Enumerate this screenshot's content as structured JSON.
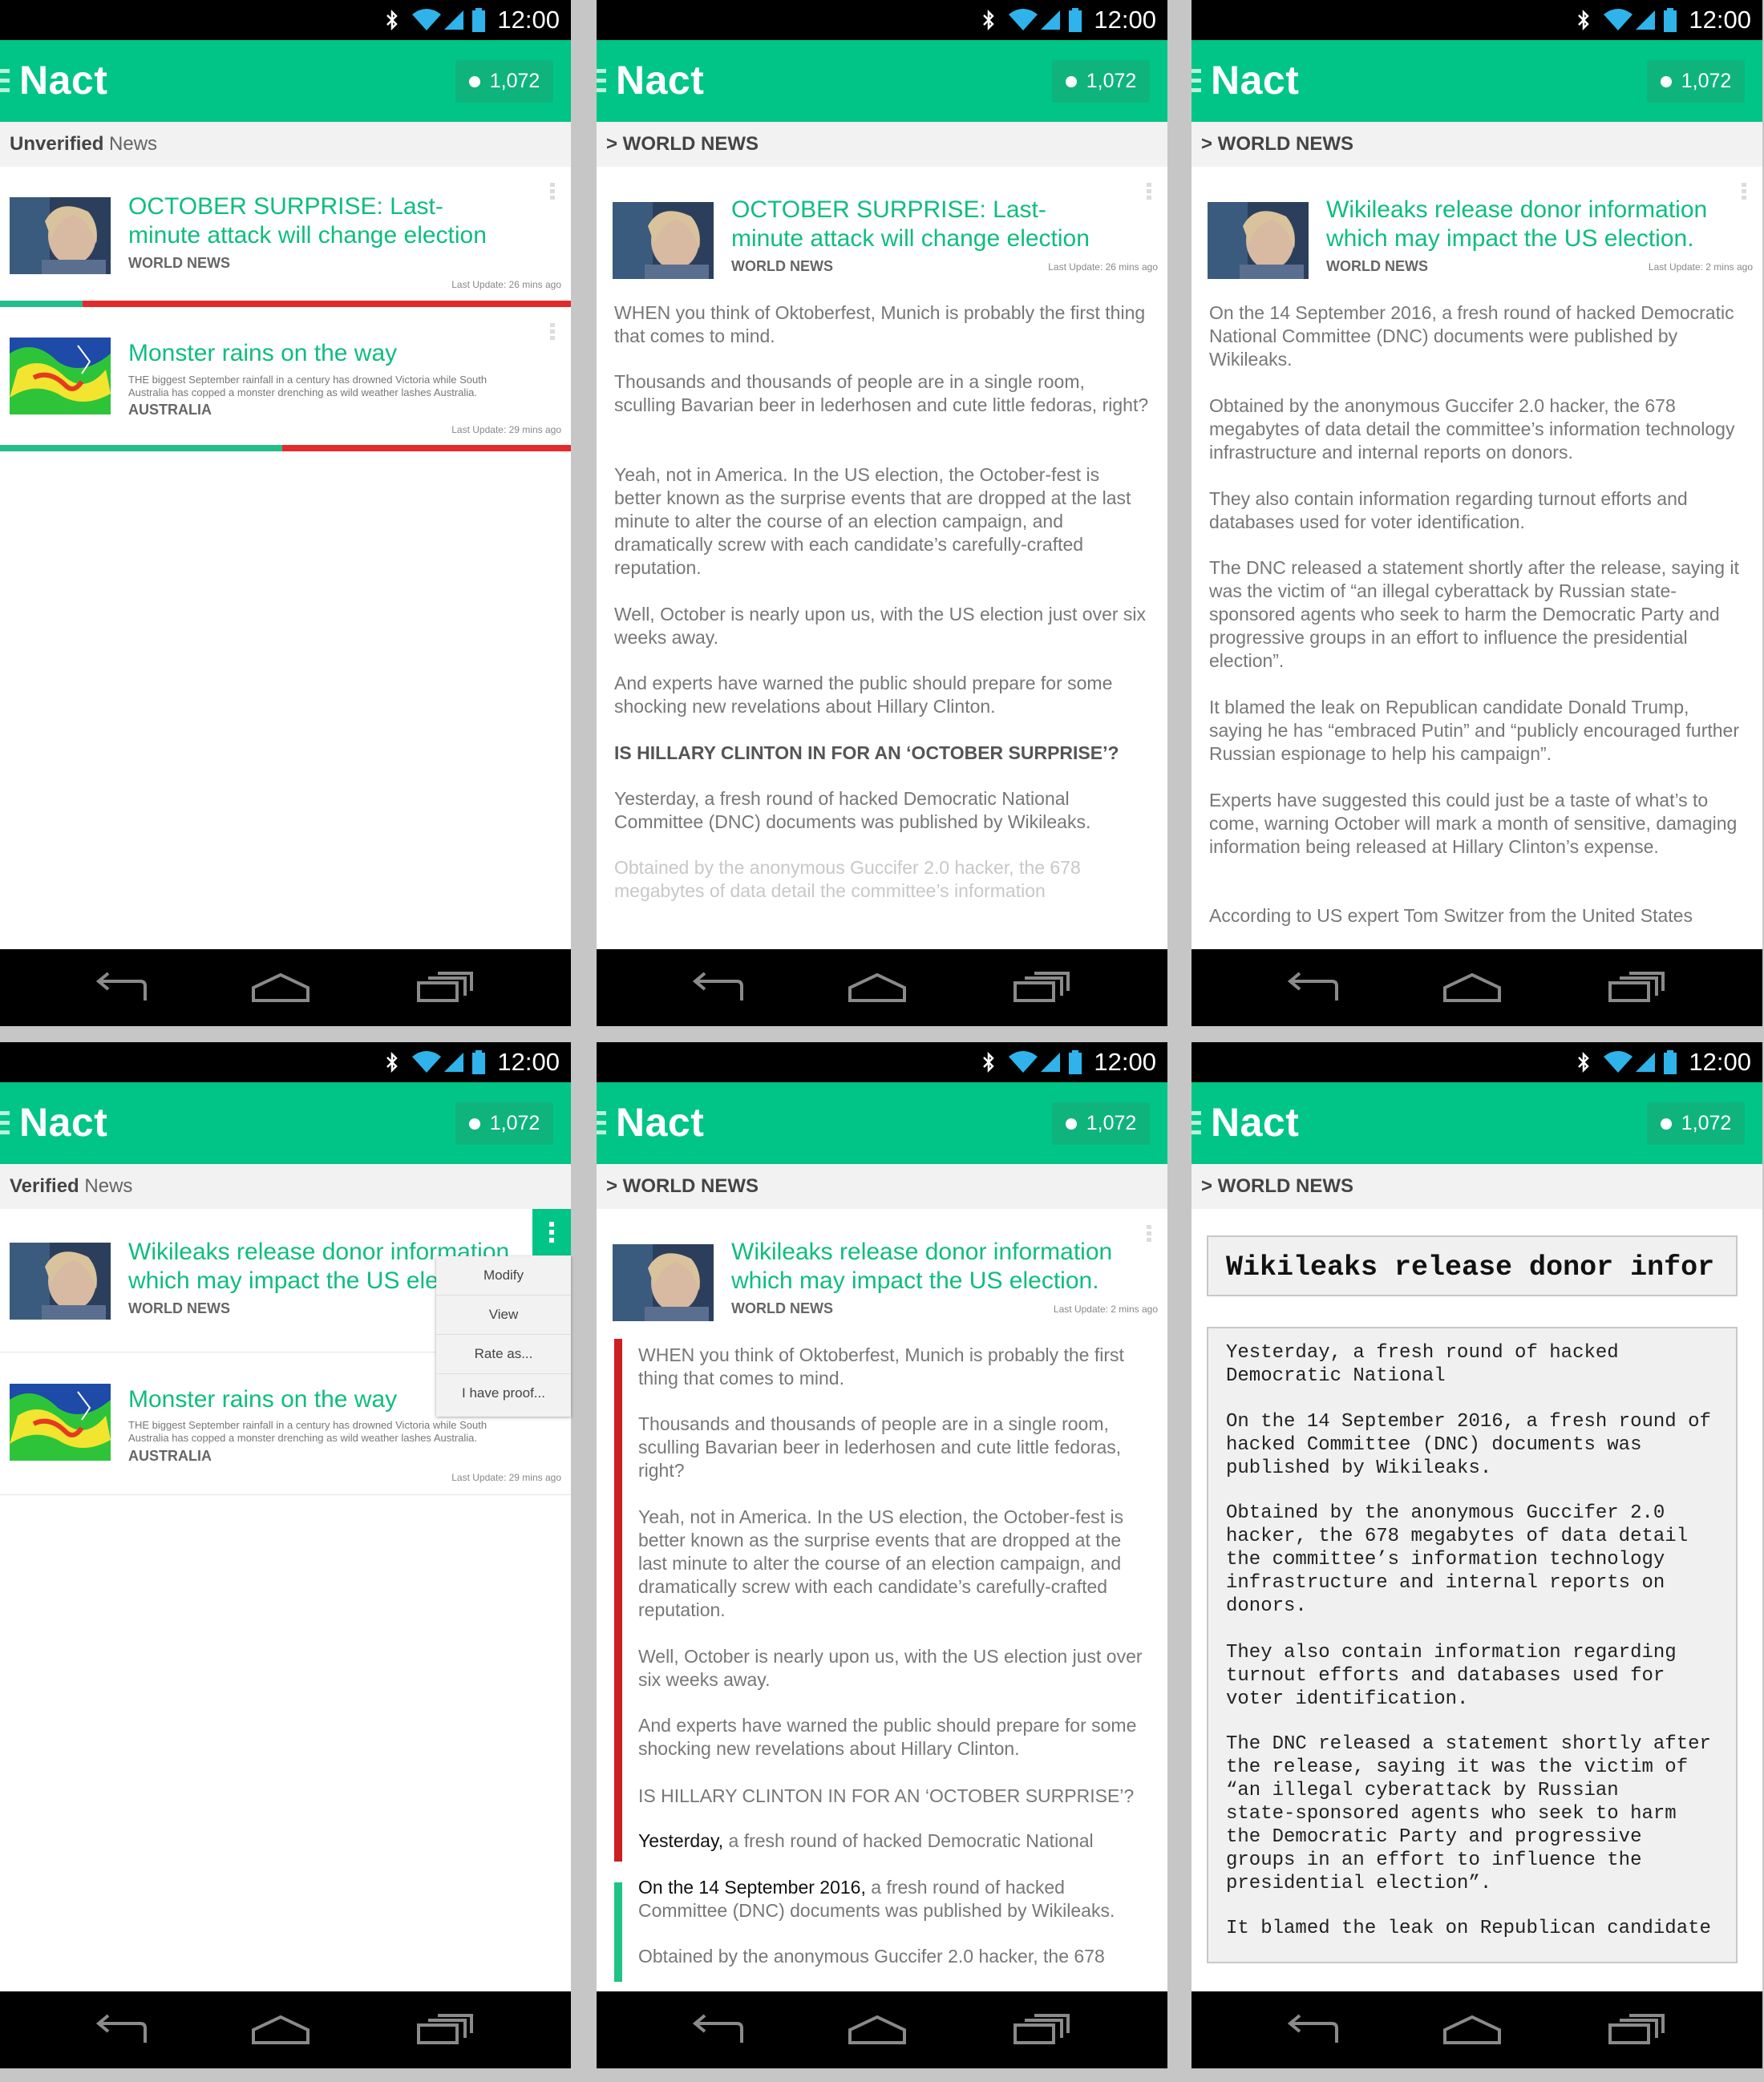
{
  "status": {
    "time": "12:00"
  },
  "app": {
    "name": "Nact",
    "count": "1,072"
  },
  "screen1": {
    "subtitle_bold": "Unverified",
    "subtitle_rest": " News",
    "cards": [
      {
        "title": "OCTOBER SURPRISE: Last-minute attack will change election",
        "category": "WORLD NEWS",
        "updated": "Last Update: 26 mins ago",
        "verified_ratio": 0.145
      },
      {
        "title": "Monster rains on the way",
        "desc": "THE biggest September rainfall in a century has drowned Victoria while South Australia has copped a monster drenching as wild weather lashes Australia.",
        "category": "AUSTRALIA",
        "updated": "Last Update: 29 mins ago",
        "verified_ratio": 0.495
      }
    ]
  },
  "screen2": {
    "subtitle": "> WORLD NEWS",
    "title": "OCTOBER SURPRISE: Last-minute attack will change election",
    "category": "WORLD NEWS",
    "updated": "Last Update: 26 mins ago",
    "paras": [
      "WHEN you think of Oktoberfest, Munich is probably the first thing that comes to mind.",
      "Thousands and thousands of people are in a single room, sculling Bavarian beer in lederhosen and cute little fedoras, right?",
      "Yeah, not in America. In the US election, the October-fest is better known as the surprise events that are dropped at the last minute to alter the course of an election campaign, and dramatically screw with each candidate’s carefully-crafted reputation.",
      "Well, October is nearly upon us, with the US election just over six weeks away.",
      "And experts have warned the public should prepare for some shocking new revelations about Hillary Clinton."
    ],
    "heading": "IS HILLARY CLINTON IN FOR AN ‘OCTOBER SURPRISE’?",
    "para_after": "Yesterday, a fresh round of hacked Democratic National Committee (DNC) documents was published by Wikileaks.",
    "para_fade": "Obtained by the anonymous Guccifer 2.0 hacker, the 678 megabytes of data detail the committee’s information"
  },
  "screen3": {
    "subtitle": "> WORLD NEWS",
    "title": "Wikileaks release donor information which may impact the US election.",
    "category": "WORLD NEWS",
    "updated": "Last Update: 2 mins ago",
    "paras": [
      "On the 14 September 2016, a fresh round of hacked Democratic National Committee (DNC) documents were published by Wikileaks.",
      "Obtained by the anonymous Guccifer 2.0 hacker, the 678 megabytes of data detail the committee’s information technology infrastructure and internal reports on donors.",
      "They also contain information regarding turnout efforts and databases used for voter identification.",
      "The DNC released a statement shortly after the release, saying it was the victim of “an illegal cyberattack by Russian state-sponsored agents who seek to harm the Democratic Party and progressive groups in an effort to influence the presidential election”.",
      "It blamed the leak on Republican candidate Donald Trump, saying he has “embraced Putin” and “publicly encouraged further Russian espionage to help his campaign”.",
      "Experts have suggested this could just be a taste of what’s to come, warning October will mark a month of sensitive, damaging information being released at Hillary Clinton’s expense.",
      "According to US expert Tom Switzer from the United States"
    ]
  },
  "screen4": {
    "subtitle_bold": "Verified",
    "subtitle_rest": " News",
    "cards": [
      {
        "title": "Wikileaks release donor information which may impact the US election.",
        "category": "WORLD NEWS"
      },
      {
        "title": "Monster rains on the way",
        "desc": "THE biggest September rainfall in a century has drowned Victoria while South Australia has copped a monster drenching as wild weather lashes Australia.",
        "category": "AUSTRALIA",
        "updated": "Last Update: 29 mins ago"
      }
    ],
    "menu": [
      "Modify",
      "View",
      "Rate as...",
      "I have proof..."
    ]
  },
  "screen5": {
    "subtitle": "> WORLD NEWS",
    "title": "Wikileaks release donor information which may impact the US election.",
    "category": "WORLD NEWS",
    "updated": "Last Update: 2 mins ago",
    "paras": [
      "WHEN you think of Oktoberfest, Munich is probably the first thing that comes to mind.",
      "Thousands and thousands of people are in a single room, sculling Bavarian beer in lederhosen and cute little fedoras, right?",
      "Yeah, not in America. In the US election, the October-fest is better known as the surprise events that are dropped at the last minute to alter the course of an election campaign, and dramatically screw with each candidate’s carefully-crafted reputation.",
      "Well, October is nearly upon us, with the US election just over six weeks away.",
      "And experts have warned the public should prepare for some shocking new revelations about Hillary Clinton.",
      "IS HILLARY CLINTON IN FOR AN ‘OCTOBER SURPRISE’?"
    ],
    "p_yesterday_lead": "Yesterday,",
    "p_yesterday_rest": " a fresh round of hacked Democratic National",
    "p_sep_lead": "On the 14 September 2016,",
    "p_sep_rest": " a fresh round of hacked Committee (DNC) documents was published by Wikileaks.",
    "p_last": "Obtained by the anonymous Guccifer 2.0 hacker, the 678"
  },
  "screen6": {
    "subtitle": "> WORLD NEWS",
    "title_input": "Wikileaks release donor infor",
    "paras": [
      "Yesterday, a fresh round of hacked\nDemocratic National",
      "On the 14 September 2016, a fresh round of\nhacked Committee (DNC) documents was\npublished by Wikileaks.",
      "Obtained by the anonymous Guccifer 2.0\nhacker, the 678 megabytes of data detail\nthe committee’s information technology\ninfrastructure and internal reports on\ndonors.",
      "They also contain information regarding\nturnout efforts and databases used for\nvoter identification.",
      "The DNC released a statement shortly after\nthe release, saying it was the victim of\n“an illegal cyberattack by Russian\nstate-sponsored agents who seek to harm\nthe Democratic Party and progressive\ngroups in an effort to influence the\npresidential election”.",
      "It blamed the leak on Republican candidate"
    ]
  },
  "colors": {
    "accent": "#00c586",
    "unverified": "#e42b2c",
    "verified": "#22bf88"
  }
}
